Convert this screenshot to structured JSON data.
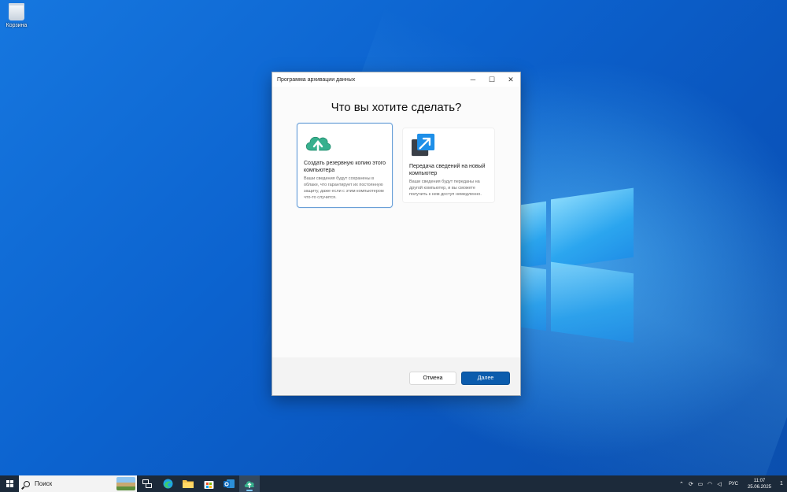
{
  "desktop": {
    "recycle_bin_label": "Корзина"
  },
  "window": {
    "title": "Программа архивации данных",
    "heading": "Что вы хотите сделать?",
    "controls": {
      "minimize": "─",
      "maximize": "☐",
      "close": "✕"
    },
    "options": [
      {
        "title": "Создать резервную копию этого компьютера",
        "description": "Ваши сведения будут сохранены в облаке, что гарантирует их постоянную защиту, даже если с этим компьютером что-то случится.",
        "icon": "cloud-upload-icon",
        "selected": true
      },
      {
        "title": "Передача сведений на новый компьютер",
        "description": "Ваши сведения будут переданы на другой компьютер, и вы сможете получить к нем доступ немедленно.",
        "icon": "transfer-arrow-icon",
        "selected": false
      }
    ],
    "buttons": {
      "cancel": "Отмена",
      "next": "Далее"
    }
  },
  "taskbar": {
    "search_placeholder": "Поиск",
    "apps": [
      "task-view-icon",
      "edge-icon",
      "file-explorer-icon",
      "store-icon",
      "outlook-icon",
      "backup-app-icon"
    ],
    "language": "РУС",
    "time": "11:07",
    "date": "25.06.2025",
    "notification_count": "1"
  },
  "colors": {
    "accent": "#0b5cad",
    "desktop": "#0c63cf",
    "taskbar": "#1c2a3a"
  }
}
